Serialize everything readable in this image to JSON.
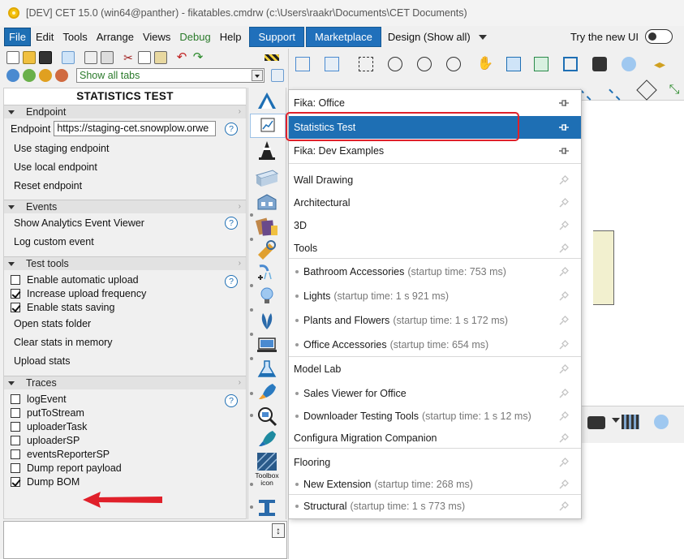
{
  "window": {
    "title": "[DEV] CET 15.0 (win64@panther) - fikatables.cmdrw (c:\\Users\\raakr\\Documents\\CET Documents)"
  },
  "menubar": {
    "items": [
      "File",
      "Edit",
      "Tools",
      "Arrange",
      "Views",
      "Debug",
      "Help"
    ],
    "support_label": "Support",
    "marketplace_label": "Marketplace",
    "design_label": "Design (Show all)",
    "try_new_ui_label": "Try the new UI"
  },
  "toolbar": {
    "tabs_select_value": "Show all tabs"
  },
  "panel": {
    "title": "STATISTICS TEST",
    "sections": {
      "endpoint": {
        "header": "Endpoint",
        "field_label": "Endpoint",
        "field_value": "https://staging-cet.snowplow.orwe",
        "actions": [
          "Use staging endpoint",
          "Use local endpoint",
          "Reset endpoint"
        ]
      },
      "events": {
        "header": "Events",
        "actions": [
          "Show Analytics Event Viewer",
          "Log custom event"
        ]
      },
      "test_tools": {
        "header": "Test tools",
        "checkboxes": [
          {
            "label": "Enable automatic upload",
            "checked": false
          },
          {
            "label": "Increase upload frequency",
            "checked": true
          },
          {
            "label": "Enable stats saving",
            "checked": true
          }
        ],
        "actions": [
          "Open stats folder",
          "Clear stats in memory",
          "Upload stats"
        ]
      },
      "traces": {
        "header": "Traces",
        "checkboxes": [
          {
            "label": "logEvent",
            "checked": false
          },
          {
            "label": "putToStream",
            "checked": false
          },
          {
            "label": "uploaderTask",
            "checked": false
          },
          {
            "label": "uploaderSP",
            "checked": false
          },
          {
            "label": "eventsReporterSP",
            "checked": false
          },
          {
            "label": "Dump report payload",
            "checked": false
          },
          {
            "label": "Dump BOM",
            "checked": true
          }
        ]
      }
    },
    "help_symbol": "?"
  },
  "iconbar": {
    "toolbox_icon_label": "Toolbox icon"
  },
  "dropdown": {
    "items": [
      {
        "label": "Fika: Office",
        "bullet": false,
        "meta": "",
        "pin": "pinned",
        "selected": false
      },
      {
        "label": "Statistics Test",
        "bullet": false,
        "meta": "",
        "pin": "pinned",
        "selected": true
      },
      {
        "label": "Fika: Dev Examples",
        "bullet": false,
        "meta": "",
        "pin": "pinned",
        "selected": false
      },
      {
        "label": "Wall Drawing",
        "bullet": false,
        "meta": "",
        "pin": "unpinned",
        "selected": false
      },
      {
        "label": "Architectural",
        "bullet": false,
        "meta": "",
        "pin": "unpinned",
        "selected": false
      },
      {
        "label": "3D",
        "bullet": false,
        "meta": "",
        "pin": "unpinned",
        "selected": false
      },
      {
        "label": "Tools",
        "bullet": false,
        "meta": "",
        "pin": "unpinned",
        "selected": false
      },
      {
        "label": "Bathroom Accessories",
        "bullet": true,
        "meta": "(startup time: 753 ms)",
        "pin": "unpinned",
        "selected": false
      },
      {
        "label": "Lights",
        "bullet": true,
        "meta": "(startup time: 1 s 921 ms)",
        "pin": "unpinned",
        "selected": false
      },
      {
        "label": "Plants and Flowers",
        "bullet": true,
        "meta": "(startup time: 1 s 172 ms)",
        "pin": "unpinned",
        "selected": false
      },
      {
        "label": "Office Accessories",
        "bullet": true,
        "meta": "(startup time: 654 ms)",
        "pin": "unpinned",
        "selected": false
      },
      {
        "label": "Model Lab",
        "bullet": false,
        "meta": "",
        "pin": "unpinned",
        "selected": false
      },
      {
        "label": "Sales Viewer for Office",
        "bullet": true,
        "meta": "",
        "pin": "unpinned",
        "selected": false
      },
      {
        "label": "Downloader Testing Tools",
        "bullet": true,
        "meta": "(startup time: 1 s 12 ms)",
        "pin": "unpinned",
        "selected": false
      },
      {
        "label": "Configura Migration Companion",
        "bullet": false,
        "meta": "",
        "pin": "unpinned",
        "selected": false
      },
      {
        "label": "Flooring",
        "bullet": false,
        "meta": "",
        "pin": "unpinned",
        "selected": false
      },
      {
        "label": "New Extension",
        "bullet": true,
        "meta": "(startup time: 268 ms)",
        "pin": "unpinned",
        "selected": false
      },
      {
        "label": "Structural",
        "bullet": true,
        "meta": "(startup time: 1 s 773 ms)",
        "pin": "unpinned",
        "selected": false
      }
    ]
  },
  "colors": {
    "accent": "#1e6fb4",
    "highlight": "#e0202a",
    "debug": "#2a7a2a"
  }
}
